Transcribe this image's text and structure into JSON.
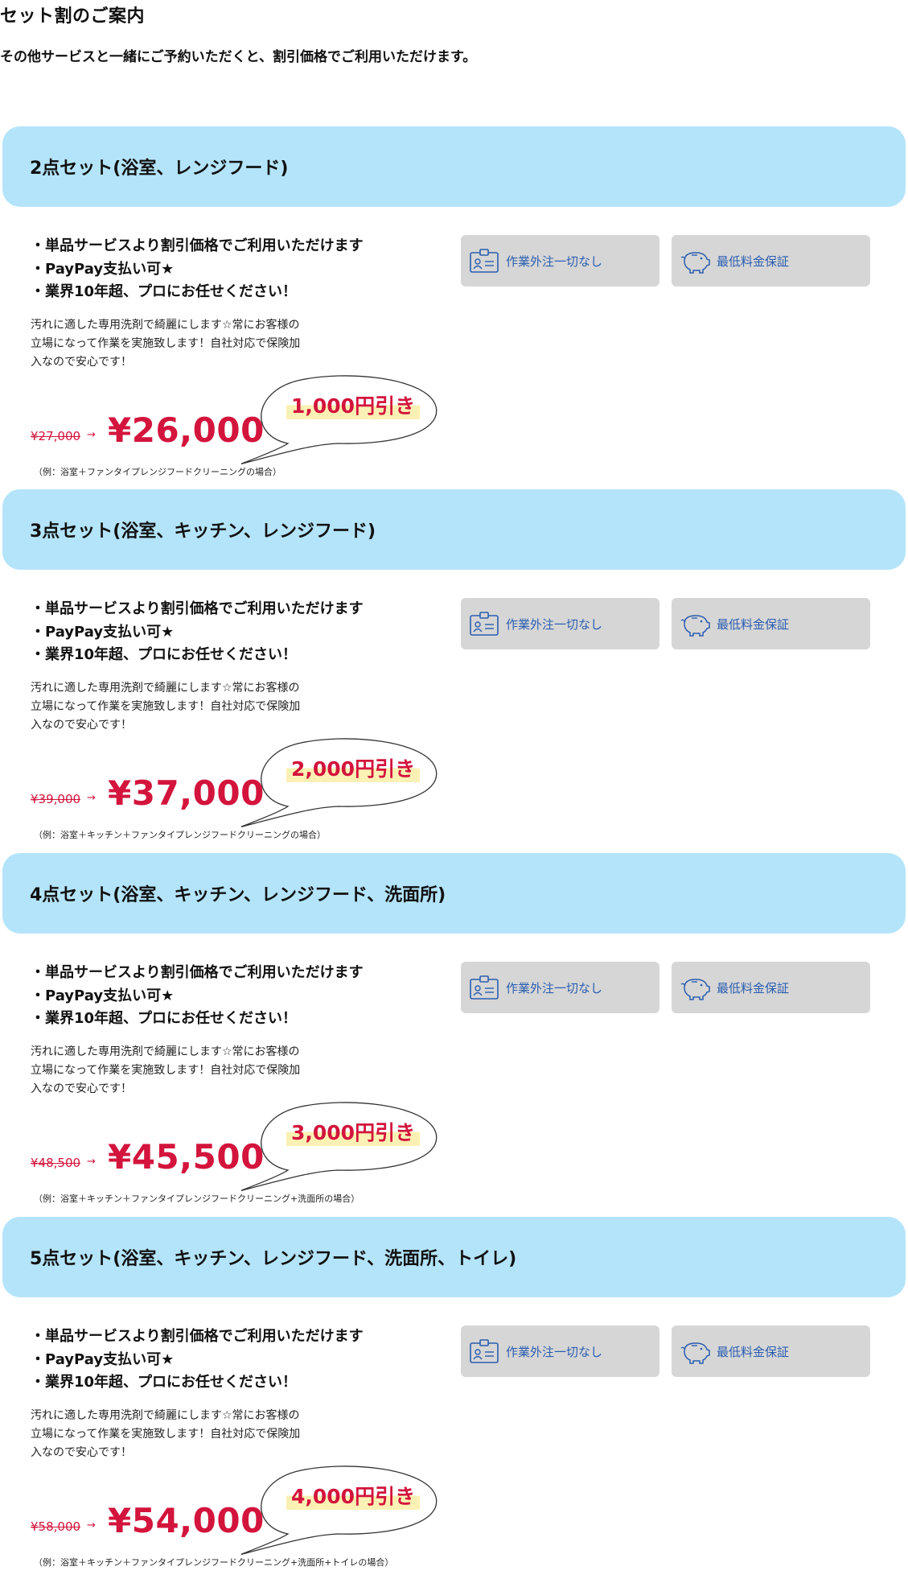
{
  "page": {
    "title": "セット割のご案内",
    "subtitle": "その他サービスと一緒にご予約いただくと、割引価格でご利用いただけます。"
  },
  "colors": {
    "header_bg": "#b4e4fa",
    "badge_bg": "#d6d6d6",
    "badge_text": "#2a5db0",
    "price_red": "#d3143c",
    "highlight_yellow": "#fbf1b4"
  },
  "sets": [
    {
      "title": "2点セット(浴室、レンジフード)",
      "bullets": [
        "・単品サービスより割引価格でご利用いただけます",
        "・PayPay支払い可★",
        "・業界10年超、プロにお任せください！"
      ],
      "description": [
        "汚れに適した専用洗剤で綺麗にします☆常にお客様の",
        "立場になって作業を実施致します！自社対応で保険加",
        "入なので安心です！"
      ],
      "badges": [
        {
          "label": "作業外注一切なし",
          "icon": "id-card-icon"
        },
        {
          "label": "最低料金保証",
          "icon": "piggy-bank-icon"
        }
      ],
      "discount": "1,000円引き",
      "old_price": "¥27,000",
      "arrow": "→",
      "price": "¥26,000",
      "example": "（例：浴室＋ファンタイプレンジフードクリーニングの場合）"
    },
    {
      "title": "3点セット(浴室、キッチン、レンジフード)",
      "bullets": [
        "・単品サービスより割引価格でご利用いただけます",
        "・PayPay支払い可★",
        "・業界10年超、プロにお任せください！"
      ],
      "description": [
        "汚れに適した専用洗剤で綺麗にします☆常にお客様の",
        "立場になって作業を実施致します！自社対応で保険加",
        "入なので安心です！"
      ],
      "badges": [
        {
          "label": "作業外注一切なし",
          "icon": "id-card-icon"
        },
        {
          "label": "最低料金保証",
          "icon": "piggy-bank-icon"
        }
      ],
      "discount": "2,000円引き",
      "old_price": "¥39,000",
      "arrow": "→",
      "price": "¥37,000",
      "example": "（例：浴室＋キッチン＋ファンタイプレンジフードクリーニングの場合）"
    },
    {
      "title": "4点セット(浴室、キッチン、レンジフード、洗面所)",
      "bullets": [
        "・単品サービスより割引価格でご利用いただけます",
        "・PayPay支払い可★",
        "・業界10年超、プロにお任せください！"
      ],
      "description": [
        "汚れに適した専用洗剤で綺麗にします☆常にお客様の",
        "立場になって作業を実施致します！自社対応で保険加",
        "入なので安心です！"
      ],
      "badges": [
        {
          "label": "作業外注一切なし",
          "icon": "id-card-icon"
        },
        {
          "label": "最低料金保証",
          "icon": "piggy-bank-icon"
        }
      ],
      "discount": "3,000円引き",
      "old_price": "¥48,500",
      "arrow": "→",
      "price": "¥45,500",
      "example": "（例：浴室＋キッチン＋ファンタイプレンジフードクリーニング+洗面所の場合）"
    },
    {
      "title": "5点セット(浴室、キッチン、レンジフード、洗面所、トイレ)",
      "bullets": [
        "・単品サービスより割引価格でご利用いただけます",
        "・PayPay支払い可★",
        "・業界10年超、プロにお任せください！"
      ],
      "description": [
        "汚れに適した専用洗剤で綺麗にします☆常にお客様の",
        "立場になって作業を実施致します！自社対応で保険加",
        "入なので安心です！"
      ],
      "badges": [
        {
          "label": "作業外注一切なし",
          "icon": "id-card-icon"
        },
        {
          "label": "最低料金保証",
          "icon": "piggy-bank-icon"
        }
      ],
      "discount": "4,000円引き",
      "old_price": "¥58,000",
      "arrow": "→",
      "price": "¥54,000",
      "example": "（例：浴室＋キッチン＋ファンタイプレンジフードクリーニング+洗面所+トイレの場合）"
    }
  ]
}
